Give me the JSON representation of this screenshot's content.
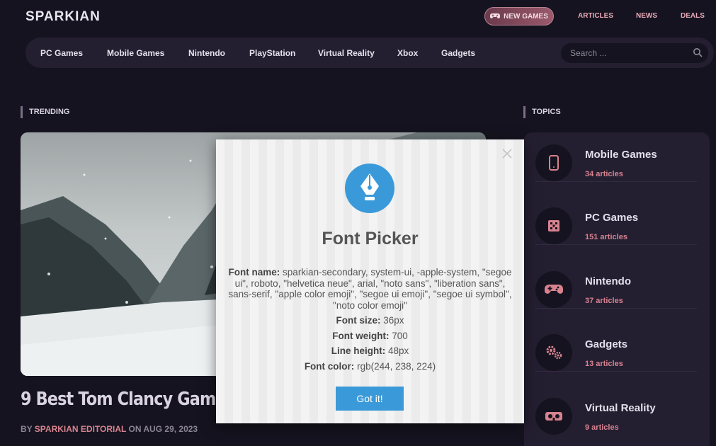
{
  "header": {
    "logo": "SPARKIAN",
    "new_games_label": "NEW GAMES",
    "links": [
      "ARTICLES",
      "NEWS",
      "DEALS"
    ]
  },
  "nav": {
    "items": [
      "PC Games",
      "Mobile Games",
      "Nintendo",
      "PlayStation",
      "Virtual Reality",
      "Xbox",
      "Gadgets"
    ],
    "search_placeholder": "Search ..."
  },
  "trending": {
    "heading": "TRENDING",
    "article_title": "9 Best Tom Clancy Games",
    "byline_prefix": "BY",
    "author": "SPARKIAN EDITORIAL",
    "byline_date": "ON AUG 29, 2023"
  },
  "topics": {
    "heading": "TOPICS",
    "items": [
      {
        "name": "Mobile Games",
        "count": "34 articles",
        "icon": "phone-icon"
      },
      {
        "name": "PC Games",
        "count": "151 articles",
        "icon": "chip-icon"
      },
      {
        "name": "Nintendo",
        "count": "37 articles",
        "icon": "gamepad-icon"
      },
      {
        "name": "Gadgets",
        "count": "13 articles",
        "icon": "gears-icon"
      },
      {
        "name": "Virtual Reality",
        "count": "9 articles",
        "icon": "vr-headset-icon"
      }
    ]
  },
  "modal": {
    "title": "Font Picker",
    "font_name_label": "Font name:",
    "font_name_value": "sparkian-secondary, system-ui, -apple-system, \"segoe ui\", roboto, \"helvetica neue\", arial, \"noto sans\", \"liberation sans\", sans-serif, \"apple color emoji\", \"segoe ui emoji\", \"segoe ui symbol\", \"noto color emoji\"",
    "font_size_label": "Font size:",
    "font_size_value": "36px",
    "font_weight_label": "Font weight:",
    "font_weight_value": "700",
    "line_height_label": "Line height:",
    "line_height_value": "48px",
    "font_color_label": "Font color:",
    "font_color_value": "rgb(244, 238, 224)",
    "button_label": "Got it!"
  },
  "colors": {
    "background": "#15131f",
    "panel": "#241e31",
    "accent_pink": "#d7838f",
    "modal_blue": "#3a9ad9"
  }
}
